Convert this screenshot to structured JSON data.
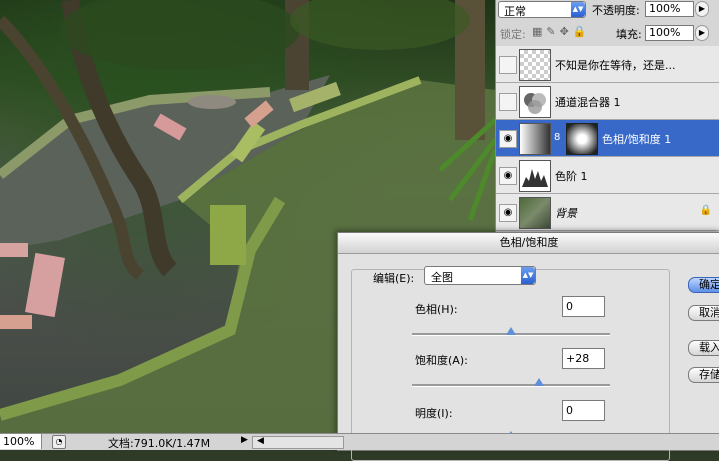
{
  "layers_panel": {
    "blend_mode": "正常",
    "opacity_label": "不透明度:",
    "opacity_value": "100%",
    "lock_label": "锁定:",
    "fill_label": "填充:",
    "fill_value": "100%",
    "layers": [
      {
        "name": "不知是你在等待，还是...",
        "visible": false,
        "thumb": "checker",
        "selected": false
      },
      {
        "name": "通道混合器 1",
        "visible": false,
        "thumb": "adjustment-channel-mixer",
        "selected": false
      },
      {
        "name": "色相/饱和度 1",
        "visible": true,
        "thumb": "adjustment-hue-saturation",
        "selected": true
      },
      {
        "name": "色阶 1",
        "visible": true,
        "thumb": "adjustment-levels",
        "selected": false
      },
      {
        "name": "背景",
        "visible": true,
        "thumb": "photo",
        "selected": false,
        "locked": true
      }
    ]
  },
  "dialog": {
    "title": "色相/饱和度",
    "edit_label": "编辑(E):",
    "edit_value": "全图",
    "fields": [
      {
        "label": "色相(H):",
        "value": "0",
        "slider_fraction": 0.5
      },
      {
        "label": "饱和度(A):",
        "value": "+28",
        "slider_fraction": 0.64
      },
      {
        "label": "明度(I):",
        "value": "0",
        "slider_fraction": 0.5
      }
    ],
    "buttons": [
      {
        "label": "确定"
      },
      {
        "label": "取消"
      },
      {
        "label": "载入..."
      },
      {
        "label": "存储..."
      }
    ]
  },
  "statusbar": {
    "zoom": "100%",
    "doc_info": "文档:791.0K/1.47M"
  },
  "icons": {
    "eye": "eye-icon",
    "chain": "chain-link-icon",
    "lock": "lock-icon",
    "dropdown": "dropdown-arrow-icon"
  },
  "colors": {
    "selection": "#3868c8",
    "slider_thumb": "#5f8fd8"
  }
}
